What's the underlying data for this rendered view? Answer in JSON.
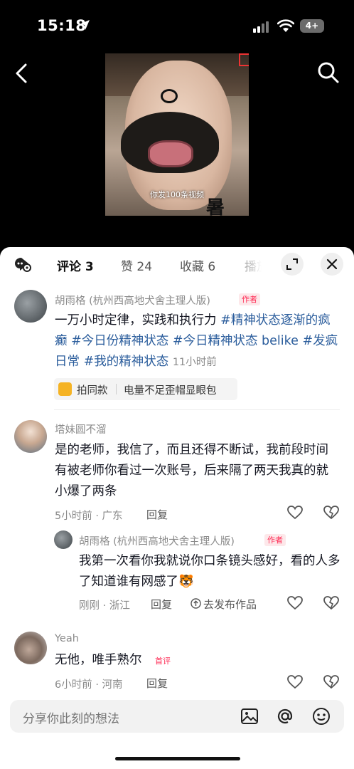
{
  "status_bar": {
    "time": "15:18",
    "battery": "4+"
  },
  "video": {
    "caption": "你发100条视频",
    "overlay_char": "暑"
  },
  "tabs": [
    {
      "label": "评论 3",
      "active": true
    },
    {
      "label": "赞 24",
      "active": false
    },
    {
      "label": "收藏 6",
      "active": false
    },
    {
      "label": "播放",
      "active": false
    }
  ],
  "comments": [
    {
      "user": "胡雨格 (杭州西高地犬舍主理人版)",
      "badge": "作者",
      "text_plain": "一万小时定律，实践和执行力 ",
      "hashtags": [
        "#精神状态逐渐的疯癫",
        "#今日份精神状态",
        "#今日精神状态 belike",
        "#发疯日常",
        "#我的精神状态"
      ],
      "time": "11小时前",
      "chip": {
        "label": "拍同款",
        "sub": "电量不足歪帽显眼包"
      }
    },
    {
      "user": "塔妹圆不溜",
      "text": "是的老师，我信了，而且还得不断试，我前段时间有被老师你看过一次账号，后来隔了两天我真的就小爆了两条",
      "meta": "5小时前 · 广东",
      "reply": "回复"
    },
    {
      "user": "胡雨格 (杭州西高地犬舍主理人版)",
      "badge": "作者",
      "text": "我第一次看你我就说你口条镜头感好，看的人多了知道谁有网感了🐯",
      "meta": "刚刚 · 浙江",
      "reply": "回复",
      "extra": "去发布作品"
    },
    {
      "user": "Yeah",
      "text": "无他，唯手熟尔",
      "badge": "首评",
      "meta": "6小时前 · 河南",
      "reply": "回复"
    }
  ],
  "input": {
    "placeholder": "分享你此刻的想法"
  },
  "colors": {
    "accent": "#fe2c55",
    "hashtag": "#2b5d9c",
    "text": "#161823",
    "meta": "#8a8a8a"
  }
}
